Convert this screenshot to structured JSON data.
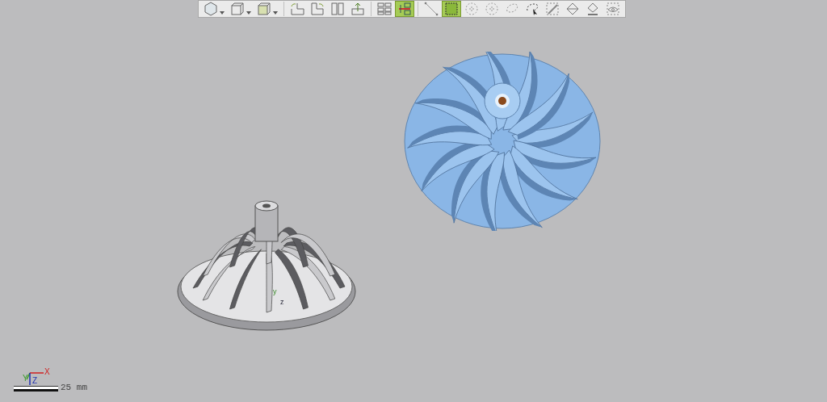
{
  "toolbar": {
    "tools": [
      {
        "selected": false,
        "dropdown": true
      },
      {
        "selected": false,
        "dropdown": true
      },
      {
        "selected": false,
        "dropdown": true
      },
      {
        "selected": false,
        "dropdown": false
      },
      {
        "selected": false,
        "dropdown": false
      },
      {
        "selected": false,
        "dropdown": false
      },
      {
        "selected": false,
        "dropdown": false
      },
      {
        "selected": false,
        "dropdown": false
      },
      {
        "selected": true,
        "dropdown": false
      },
      {
        "selected": false,
        "dropdown": false
      },
      {
        "selected": true,
        "dropdown": false
      },
      {
        "selected": false,
        "dropdown": false
      },
      {
        "selected": false,
        "dropdown": false
      },
      {
        "selected": false,
        "dropdown": false
      },
      {
        "selected": false,
        "dropdown": false
      },
      {
        "selected": false,
        "dropdown": false
      },
      {
        "selected": false,
        "dropdown": false
      },
      {
        "selected": false,
        "dropdown": false
      },
      {
        "selected": false,
        "dropdown": false
      }
    ]
  },
  "model_axes": {
    "y_label": "y",
    "z_label": "z"
  },
  "axis_triad": {
    "x_label": "X",
    "y_label": "Y",
    "z_label": "Z"
  },
  "scale_bar": {
    "label": "25 mm"
  }
}
